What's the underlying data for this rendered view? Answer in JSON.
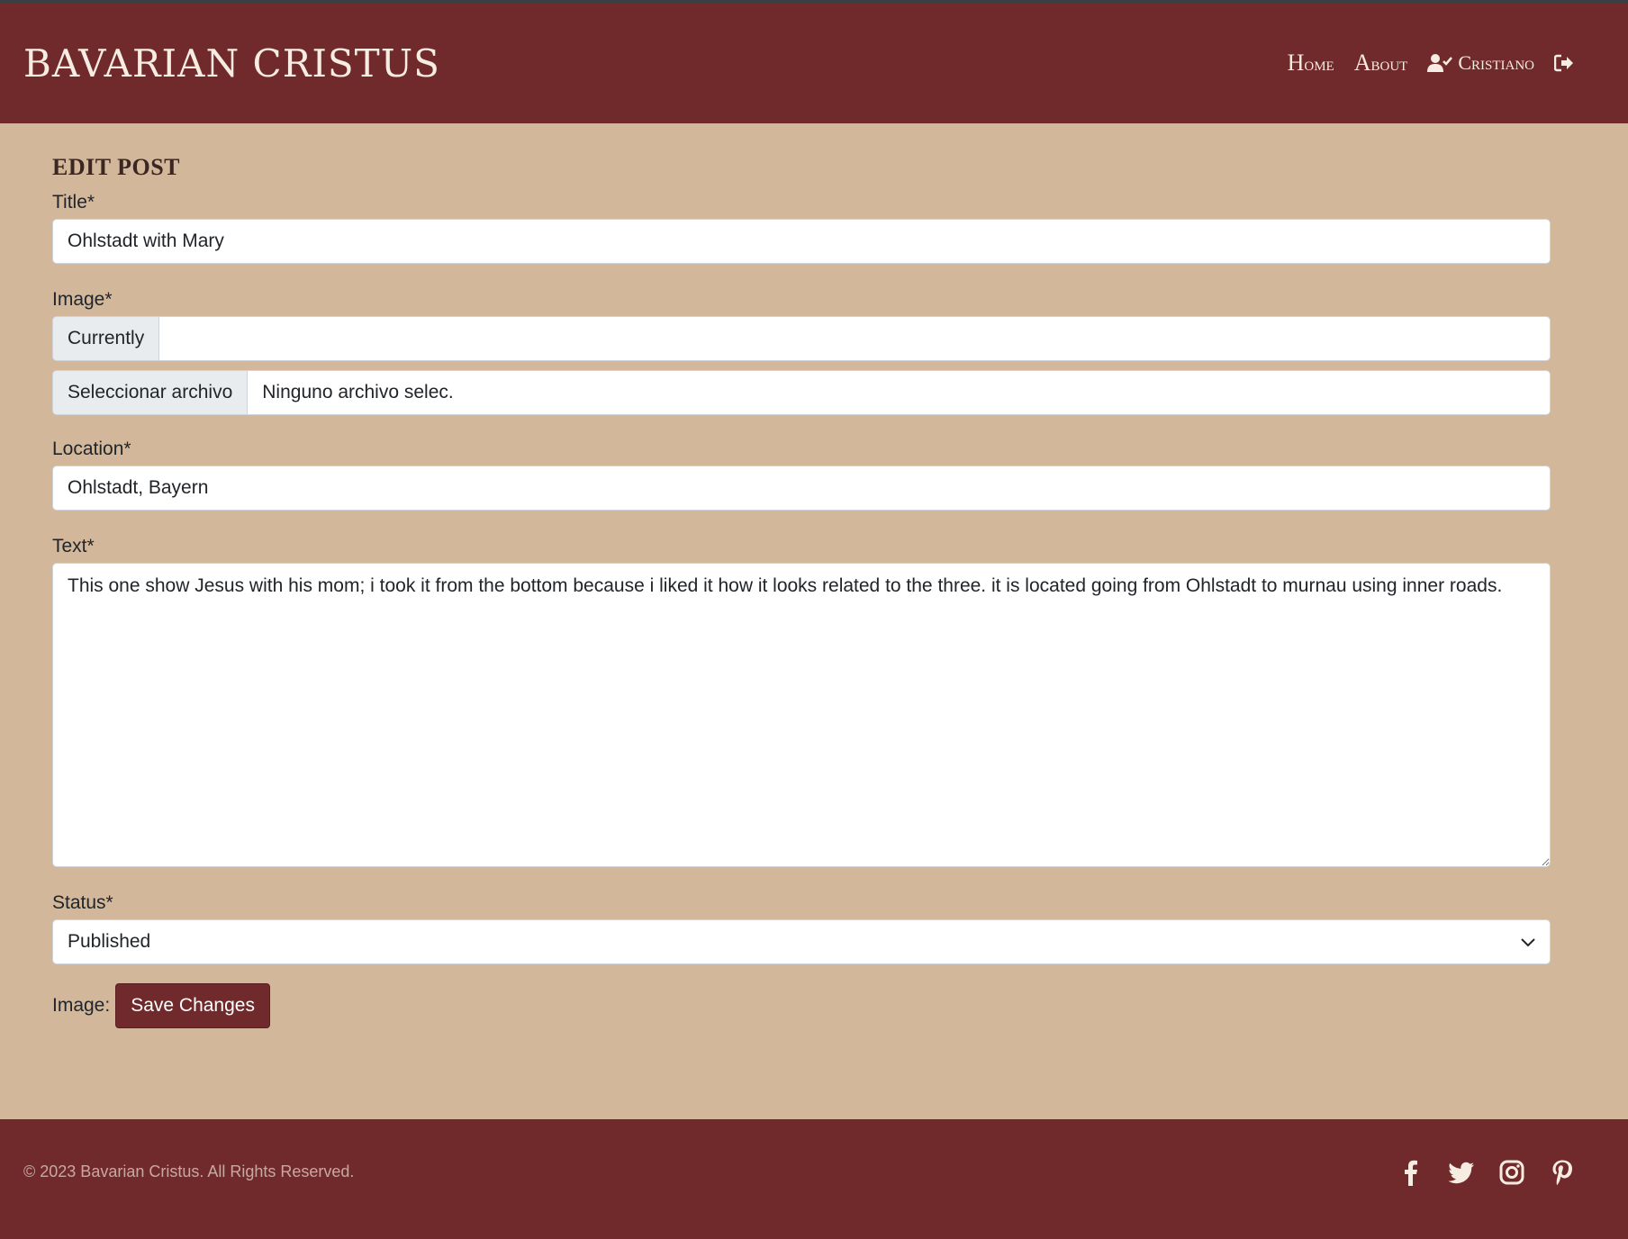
{
  "navbar": {
    "brand": "Bavarian Cristus",
    "home_lead": "H",
    "home_rest": "ome",
    "about_lead": "A",
    "about_rest": "bout",
    "user": "Cristiano",
    "icons": [
      "user-check-icon",
      "logout-icon"
    ]
  },
  "page": {
    "heading": "Edit Post"
  },
  "form": {
    "title_label": "Title*",
    "title_value": "Ohlstadt with Mary",
    "image_label": "Image*",
    "currently_label": "Currently",
    "currently_value": "",
    "file_button": "Seleccionar archivo",
    "file_status": "Ninguno archivo selec.",
    "location_label": "Location*",
    "location_value": "Ohlstadt, Bayern",
    "text_label": "Text*",
    "text_value": "This one show Jesus with his mom; i took it from the bottom because i liked it how it looks related to the three. it is located going from Ohlstadt to murnau using inner roads.",
    "status_label": "Status*",
    "status_value": "Published",
    "image_caption": "Image:",
    "submit": "Save Changes"
  },
  "footer": {
    "copyright": "© 2023 Bavarian Cristus. All Rights Reserved.",
    "social_icons": [
      "facebook-icon",
      "twitter-icon",
      "instagram-icon",
      "pinterest-icon"
    ]
  },
  "colors": {
    "brand": "#712a2c",
    "background": "#d3b79a",
    "nav_text": "#f6ece1"
  }
}
